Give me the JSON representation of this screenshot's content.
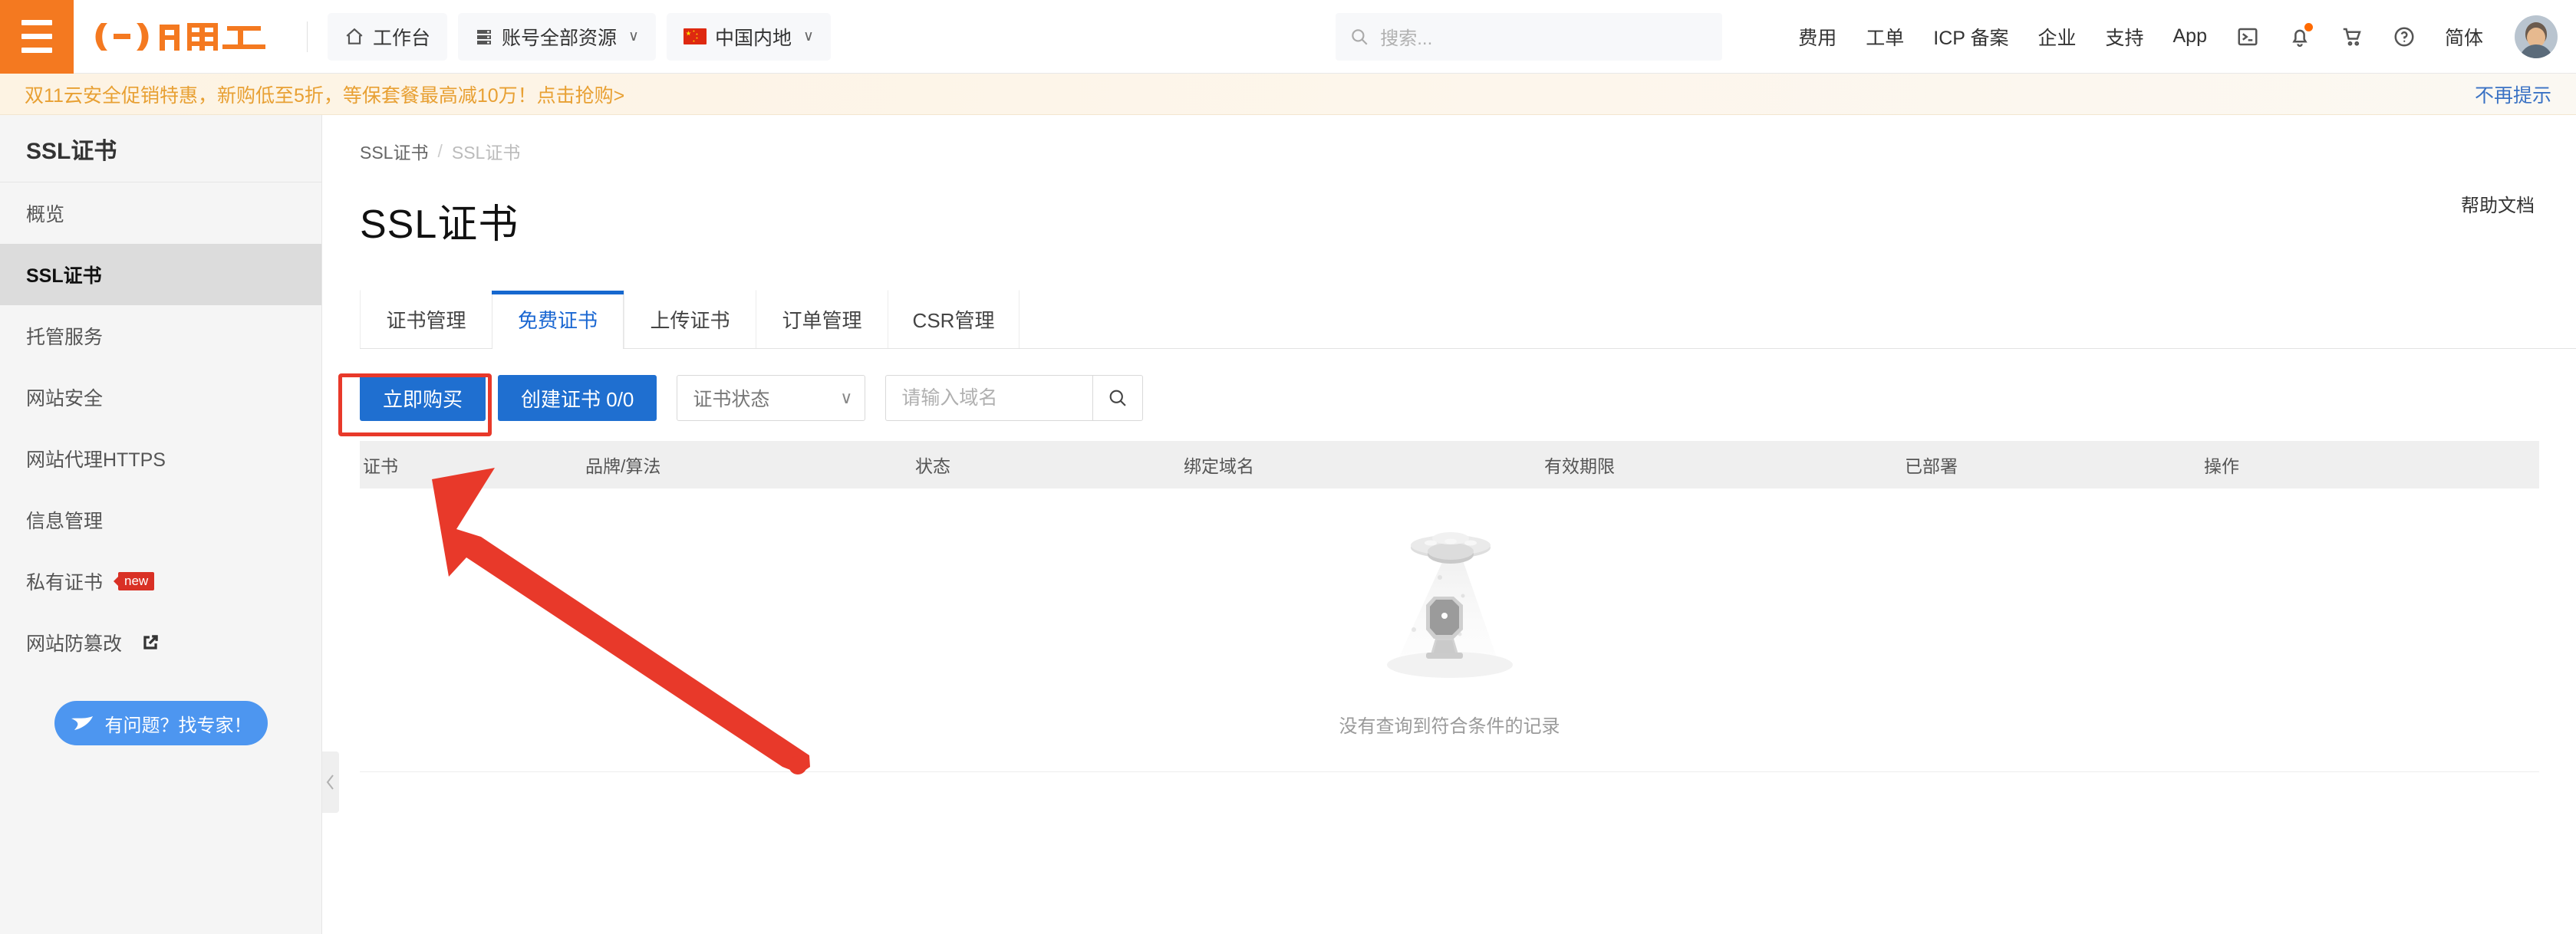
{
  "header": {
    "menu_icon": "hamburger-icon",
    "logo_text": "阿里云",
    "nav_items": [
      {
        "label": "工作台",
        "icon": "home-icon",
        "caret": ""
      },
      {
        "label": "账号全部资源",
        "icon": "server-icon",
        "caret": "∨"
      },
      {
        "label": "中国内地",
        "icon": "china-flag-icon",
        "caret": "∨"
      }
    ],
    "search_placeholder": "搜索...",
    "links": [
      "费用",
      "工单",
      "ICP 备案",
      "企业",
      "支持",
      "App"
    ],
    "icons": [
      "terminal-icon",
      "bell-icon",
      "cart-icon",
      "help-circle-icon"
    ],
    "language": "简体",
    "avatar": "user-avatar"
  },
  "promo": {
    "text": "双11云安全促销特惠，新购低至5折，等保套餐最高减10万！点击抢购>",
    "dismiss": "不再提示"
  },
  "sidebar": {
    "title": "SSL证书",
    "items": [
      {
        "label": "概览",
        "active": false,
        "badge": "",
        "external": false
      },
      {
        "label": "SSL证书",
        "active": true,
        "badge": "",
        "external": false
      },
      {
        "label": "托管服务",
        "active": false,
        "badge": "",
        "external": false
      },
      {
        "label": "网站安全",
        "active": false,
        "badge": "",
        "external": false
      },
      {
        "label": "网站代理HTTPS",
        "active": false,
        "badge": "",
        "external": false
      },
      {
        "label": "信息管理",
        "active": false,
        "badge": "",
        "external": false
      },
      {
        "label": "私有证书",
        "active": false,
        "badge": "new",
        "external": false
      },
      {
        "label": "网站防篡改",
        "active": false,
        "badge": "",
        "external": true
      }
    ],
    "expert_button": "有问题？找专家！"
  },
  "collapse_handle": "‹",
  "main": {
    "breadcrumb": {
      "root": "SSL证书",
      "separator": "/",
      "current": "SSL证书"
    },
    "help_doc": "帮助文档",
    "page_title": "SSL证书",
    "tabs": [
      {
        "label": "证书管理",
        "active": false
      },
      {
        "label": "免费证书",
        "active": true
      },
      {
        "label": "上传证书",
        "active": false
      },
      {
        "label": "订单管理",
        "active": false
      },
      {
        "label": "CSR管理",
        "active": false
      }
    ],
    "toolbar": {
      "buy_now": "立即购买",
      "create_cert": "创建证书 0/0",
      "status_filter": "证书状态",
      "status_caret": "∨",
      "domain_placeholder": "请输入域名",
      "domain_value": "",
      "search_icon": "search-icon"
    },
    "table": {
      "columns": [
        "证书",
        "品牌/算法",
        "状态",
        "绑定域名",
        "有效期限",
        "已部署",
        "操作"
      ],
      "rows": [],
      "empty_text": "没有查询到符合条件的记录",
      "empty_illustration": "ufo-robot-illustration"
    }
  },
  "annotation": {
    "highlight_target": "立即购买",
    "arrow_color": "#e8392a",
    "box_color": "#e8392a"
  },
  "colors": {
    "brand_orange": "#f47920",
    "primary_blue": "#1f6fd0",
    "tab_active_blue": "#1668cf",
    "banner_bg": "#fdf3e3",
    "banner_text": "#e8a033",
    "link_blue": "#3a72c4",
    "badge_red": "#d93025"
  }
}
